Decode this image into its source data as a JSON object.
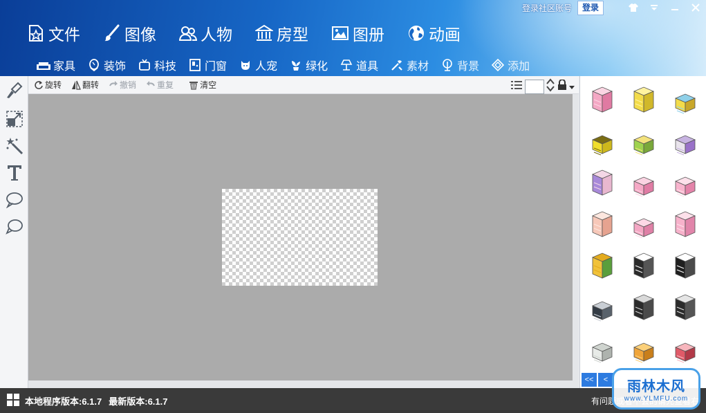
{
  "header": {
    "login_text": "登录社区账号",
    "login_button": "登录",
    "main_menu": [
      {
        "label": "文件",
        "icon": "file-star-icon"
      },
      {
        "label": "图像",
        "icon": "brush-icon"
      },
      {
        "label": "人物",
        "icon": "people-icon"
      },
      {
        "label": "房型",
        "icon": "building-icon"
      },
      {
        "label": "图册",
        "icon": "picture-icon"
      },
      {
        "label": "动画",
        "icon": "globe-icon"
      }
    ],
    "sub_menu": [
      {
        "label": "家具",
        "icon": "sofa-icon"
      },
      {
        "label": "装饰",
        "icon": "mirror-icon"
      },
      {
        "label": "科技",
        "icon": "tv-icon"
      },
      {
        "label": "门窗",
        "icon": "door-icon"
      },
      {
        "label": "人宠",
        "icon": "pet-icon"
      },
      {
        "label": "绿化",
        "icon": "plant-icon"
      },
      {
        "label": "道具",
        "icon": "lamp-icon"
      },
      {
        "label": "素材",
        "icon": "tools-icon"
      },
      {
        "label": "背景",
        "icon": "tree-icon"
      },
      {
        "label": "添加",
        "icon": "diamond-icon"
      }
    ]
  },
  "toolbar": {
    "rotate": "旋转",
    "flip": "翻转",
    "undo": "撤销",
    "redo": "重复",
    "clear": "清空"
  },
  "left_tools": [
    "brush-tool-icon",
    "resize-tool-icon",
    "magic-wand-icon",
    "text-tool-icon",
    "speech-bubble-icon",
    "thought-bubble-icon"
  ],
  "right_panel": {
    "items": [
      {
        "body": "#f4a7c4",
        "side": "#e07aa2",
        "trim": "#fbd5e3"
      },
      {
        "body": "#f3dc4a",
        "side": "#d1b82a",
        "trim": "#fff3a0"
      },
      {
        "body": "#f3dc4a",
        "side": "#c9a72a",
        "trim": "#8fd0e8"
      },
      {
        "body": "#f0de2d",
        "side": "#cdb81c",
        "trim": "#7a6d14"
      },
      {
        "body": "#9fd34e",
        "side": "#7aa83a",
        "trim": "#f3e27c"
      },
      {
        "body": "#e9e4ec",
        "side": "#9a72c9",
        "trim": "#c7b3e1"
      },
      {
        "body": "#a889d9",
        "side": "#e8b7cf",
        "trim": "#f4d7e6"
      },
      {
        "body": "#f6a9c6",
        "side": "#e07ca4",
        "trim": "#fbd3e2"
      },
      {
        "body": "#f8b4cd",
        "side": "#e483a9",
        "trim": "#fde0ea"
      },
      {
        "body": "#f7c8b9",
        "side": "#e6a390",
        "trim": "#fde7df"
      },
      {
        "body": "#f4a7c4",
        "side": "#df80a6",
        "trim": "#fdd8e6"
      },
      {
        "body": "#f7b2cb",
        "side": "#e185aa",
        "trim": "#fde0ea"
      },
      {
        "body": "#f1c23a",
        "side": "#5a9e3c",
        "trim": "#e3ab1e"
      },
      {
        "body": "#2a2a2a",
        "side": "#555555",
        "trim": "#ffffff"
      },
      {
        "body": "#1f1f1f",
        "side": "#4a4a4a",
        "trim": "#ffffff"
      },
      {
        "body": "#333b44",
        "side": "#59626b",
        "trim": "#c9ced4"
      },
      {
        "body": "#2b2b2b",
        "side": "#4a4a4a",
        "trim": "#d9d9d9"
      },
      {
        "body": "#2b2b2b",
        "side": "#555555",
        "trim": "#e5e5e5"
      },
      {
        "body": "#e8ebe8",
        "side": "#aeb3ae",
        "trim": "#cfd4cf"
      },
      {
        "body": "#f0a53a",
        "side": "#c97f1c",
        "trim": "#fbd07a"
      },
      {
        "body": "#e05a68",
        "side": "#b23a48",
        "trim": "#f7b6bd"
      }
    ],
    "pager_prev_all": "<<",
    "pager_prev": "<"
  },
  "status": {
    "local_version": "本地程序版本:6.1.7",
    "latest_version": "最新版本:6.1.7",
    "help_text": "有问题或者不会的请先查看右"
  },
  "watermark": {
    "title": "雨林木风",
    "subtitle": "www.YLMFU.com"
  },
  "colors": {
    "header_dark": "#0a3e98",
    "header_light": "#d5ecfb",
    "canvas": "#ababab",
    "status_bar": "#3a3a3a",
    "accent": "#2d7be0"
  }
}
